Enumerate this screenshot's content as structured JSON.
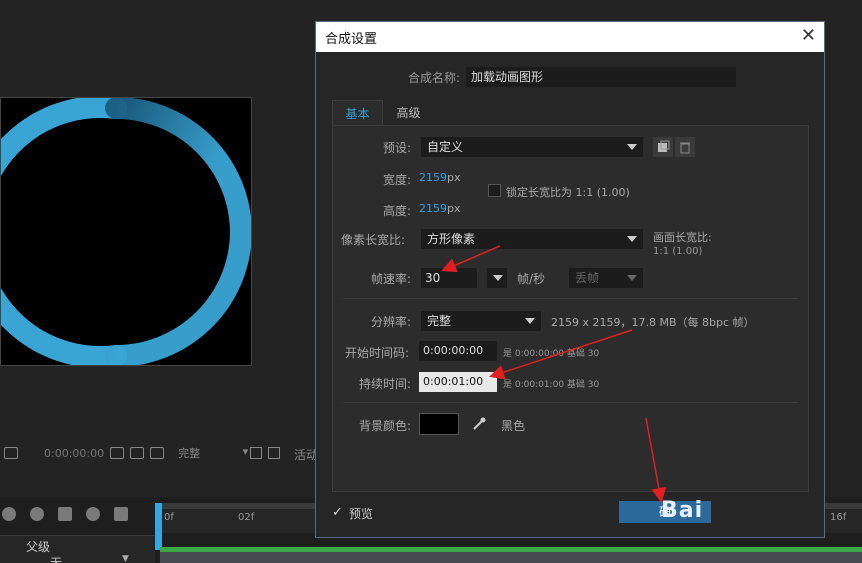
{
  "background": {
    "viewer": {
      "timecode": "0:00:00:00",
      "resolution": "完整",
      "active_label": "活动"
    },
    "timeline": {
      "ticks": [
        "0f",
        "02f",
        "16f"
      ],
      "parent_label": "父级",
      "none_label": "无"
    }
  },
  "dialog": {
    "title": "合成设置",
    "close_label": "✕",
    "comp_name_label": "合成名称:",
    "comp_name_value": "加载动画图形",
    "tabs": [
      {
        "label": "基本"
      },
      {
        "label": "高级"
      }
    ],
    "preset": {
      "label": "预设:",
      "value": "自定义"
    },
    "width": {
      "label": "宽度:",
      "value": "2159",
      "unit": "px"
    },
    "height": {
      "label": "高度:",
      "value": "2159",
      "unit": "px"
    },
    "lock_aspect_label": "锁定长宽比为 1:1 (1.00)",
    "pixel_aspect": {
      "label": "像素长宽比:",
      "value": "方形像素"
    },
    "frame_aspect": {
      "label": "画面长宽比:",
      "value": "1:1 (1.00)"
    },
    "frame_rate": {
      "label": "帧速率:",
      "value": "30",
      "unit": "帧/秒",
      "drop_frame": "丢帧"
    },
    "resolution": {
      "label": "分辨率:",
      "value": "完整",
      "info": "2159 x 2159，17.8 MB（每 8bpc 帧）"
    },
    "start_timecode": {
      "label": "开始时间码:",
      "value": "0:00:00:00",
      "note": "是 0:00:00:00  基础 30"
    },
    "duration": {
      "label": "持续时间:",
      "value": "0:00:01:00",
      "note": "是 0:00:01:00  基础 30"
    },
    "bg_color": {
      "label": "背景颜色:",
      "name": "黑色",
      "swatch": "#000000"
    },
    "preview_label": "预览",
    "ok_label": "确",
    "watermark": "Bai"
  },
  "colors": {
    "accent": "#35a0dc",
    "ring": "#3aa0d0",
    "arrow": "#e02020"
  }
}
